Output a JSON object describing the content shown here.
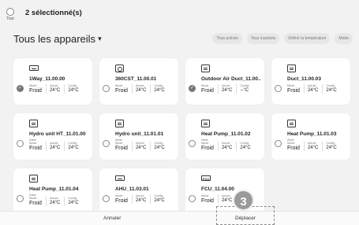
{
  "topbar": {
    "select_all_label": "Tout",
    "selected_count": "2 sélectionné(s)"
  },
  "header": {
    "title": "Tous les appareils",
    "chevron": "▾"
  },
  "filters": [
    "Tous activés",
    "Tous inactivés",
    "Définir la température",
    "Mode"
  ],
  "labels": {
    "zone": "Zone",
    "mode": "Mode",
    "actual": "Actuel",
    "config": "Config"
  },
  "devices": [
    {
      "name": "1Way_11.00.00",
      "icon": "indoor-unit-icon",
      "selected": true,
      "mode": "Froid",
      "actual": "24°C",
      "config": "24°C"
    },
    {
      "name": "360CST_11.00.01",
      "icon": "cassette-icon",
      "selected": false,
      "mode": "Froid",
      "actual": "24°C",
      "config": "24°C"
    },
    {
      "name": "Outdoor Air Duct_11.00...",
      "icon": "duct-icon",
      "selected": true,
      "mode": "Froid",
      "actual": "24°C",
      "config": "--°C"
    },
    {
      "name": "Duct_11.00.03",
      "icon": "duct-icon",
      "selected": false,
      "mode": "Froid",
      "actual": "24°C",
      "config": "24°C"
    },
    {
      "name": "Hydro unit HT_11.01.00",
      "icon": "hydro-unit-icon",
      "selected": false,
      "zone": true,
      "mode": "Froid",
      "actual": "24°C",
      "config": "24°C"
    },
    {
      "name": "Hydro unit_11.01.01",
      "icon": "hydro-unit-icon",
      "selected": false,
      "zone": true,
      "mode": "Froid",
      "actual": "24°C",
      "config": "24°C"
    },
    {
      "name": "Heat Pump_11.01.02",
      "icon": "heat-pump-icon",
      "selected": false,
      "zone": true,
      "mode": "Froid",
      "actual": "24°C",
      "config": "24°C"
    },
    {
      "name": "Heat Pump_11.01.03",
      "icon": "heat-pump-icon",
      "selected": false,
      "zone": true,
      "mode": "Froid",
      "actual": "24°C",
      "config": "24°C"
    },
    {
      "name": "Heat Pump_11.01.04",
      "icon": "heat-pump-icon",
      "selected": false,
      "zone": true,
      "mode": "Froid",
      "actual": "24°C",
      "config": "24°C"
    },
    {
      "name": "AHU_11.03.01",
      "icon": "ahu-icon",
      "selected": false,
      "mode": "Froid",
      "actual": "24°C",
      "config": "24°C"
    },
    {
      "name": "FCU_11.04.00",
      "icon": "fcu-icon",
      "icon_text": "FCU",
      "selected": false,
      "mode": "Froid",
      "actual": "24°C",
      "config": "24°C"
    }
  ],
  "bottombar": {
    "cancel_label": "Annuler",
    "move_label": "Déplacer"
  },
  "badge": "3"
}
